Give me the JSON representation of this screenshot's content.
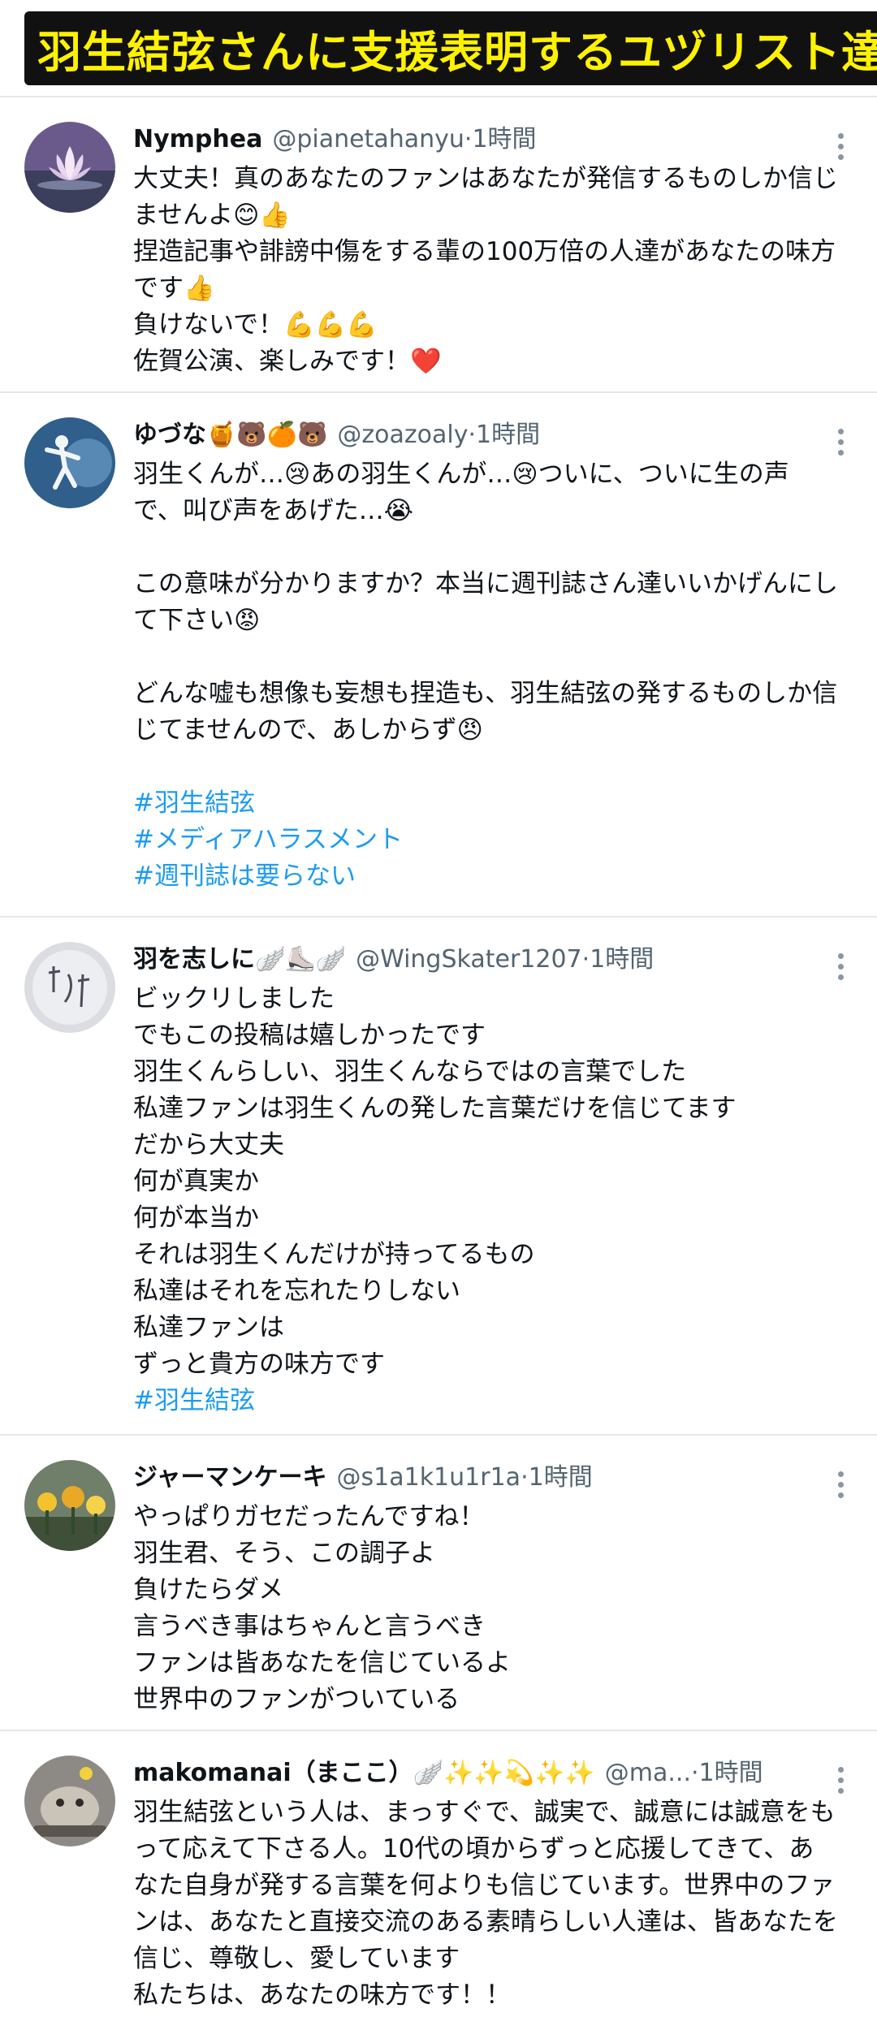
{
  "banner": {
    "title": "羽生結弦さんに支援表明するユヅリスト達"
  },
  "posts": [
    {
      "name": "Nymphea",
      "handle": "@pianetahanyu",
      "dot": "·",
      "time": "1時間",
      "lines": [
        "大丈夫！真のあなたのファンはあなたが発信するものしか信じ",
        "ませんよ😊👍",
        "捏造記事や誹謗中傷をする輩の100万倍の人達があなたの味方",
        "です👍",
        "負けないで！💪💪💪",
        "佐賀公演、楽しみです！❤️"
      ],
      "hashtags": []
    },
    {
      "name": "ゆづな🍯🐻🍊🐻",
      "handle": "@zoazoaly",
      "dot": "·",
      "time": "1時間",
      "lines": [
        "羽生くんが…😢あの羽生くんが…😢ついに、ついに生の声",
        "で、叫び声をあげた…😭",
        "",
        "この意味が分かりますか？本当に週刊誌さん達いいかげんにし",
        "て下さい😡",
        "",
        "どんな嘘も想像も妄想も捏造も、羽生結弦の発するものしか信",
        "じてませんので、あしからず😠",
        ""
      ],
      "hashtags": [
        "#羽生結弦",
        "#メディアハラスメント",
        "#週刊誌は要らない"
      ]
    },
    {
      "name": "羽を志しに🪽⛸️🪽",
      "handle": "@WingSkater1207",
      "dot": "·",
      "time": "1時間",
      "lines": [
        "ビックリしました",
        "でもこの投稿は嬉しかったです",
        "羽生くんらしい、羽生くんならではの言葉でした",
        "私達ファンは羽生くんの発した言葉だけを信じてます",
        "だから大丈夫",
        "何が真実か",
        "何が本当か",
        "それは羽生くんだけが持ってるもの",
        "私達はそれを忘れたりしない",
        "私達ファンは",
        "ずっと貴方の味方です"
      ],
      "hashtags": [
        " #羽生結弦"
      ]
    },
    {
      "name": "ジャーマンケーキ",
      "handle": "@s1a1k1u1r1a",
      "dot": "·",
      "time": "1時間",
      "lines": [
        "やっぱりガセだったんですね！",
        "羽生君、そう、この調子よ",
        "負けたらダメ",
        "言うべき事はちゃんと言うべき",
        "ファンは皆あなたを信じているよ",
        "世界中のファンがついている"
      ],
      "hashtags": []
    },
    {
      "name": "makomanai（まここ）🪽✨✨💫✨✨",
      "handle": "@ma...",
      "dot": "·",
      "time": "1時間",
      "lines": [
        "羽生結弦という人は、まっすぐで、誠実で、誠意には誠意をも",
        "って応えて下さる人。10代の頃からずっと応援してきて、あ",
        "なた自身が発する言葉を何よりも信じています。世界中のファ",
        "ンは、あなたと直接交流のある素晴らしい人達は、皆あなたを",
        "信じ、尊敬し、愛しています",
        "私たちは、あなたの味方です！！"
      ],
      "hashtags": []
    }
  ]
}
